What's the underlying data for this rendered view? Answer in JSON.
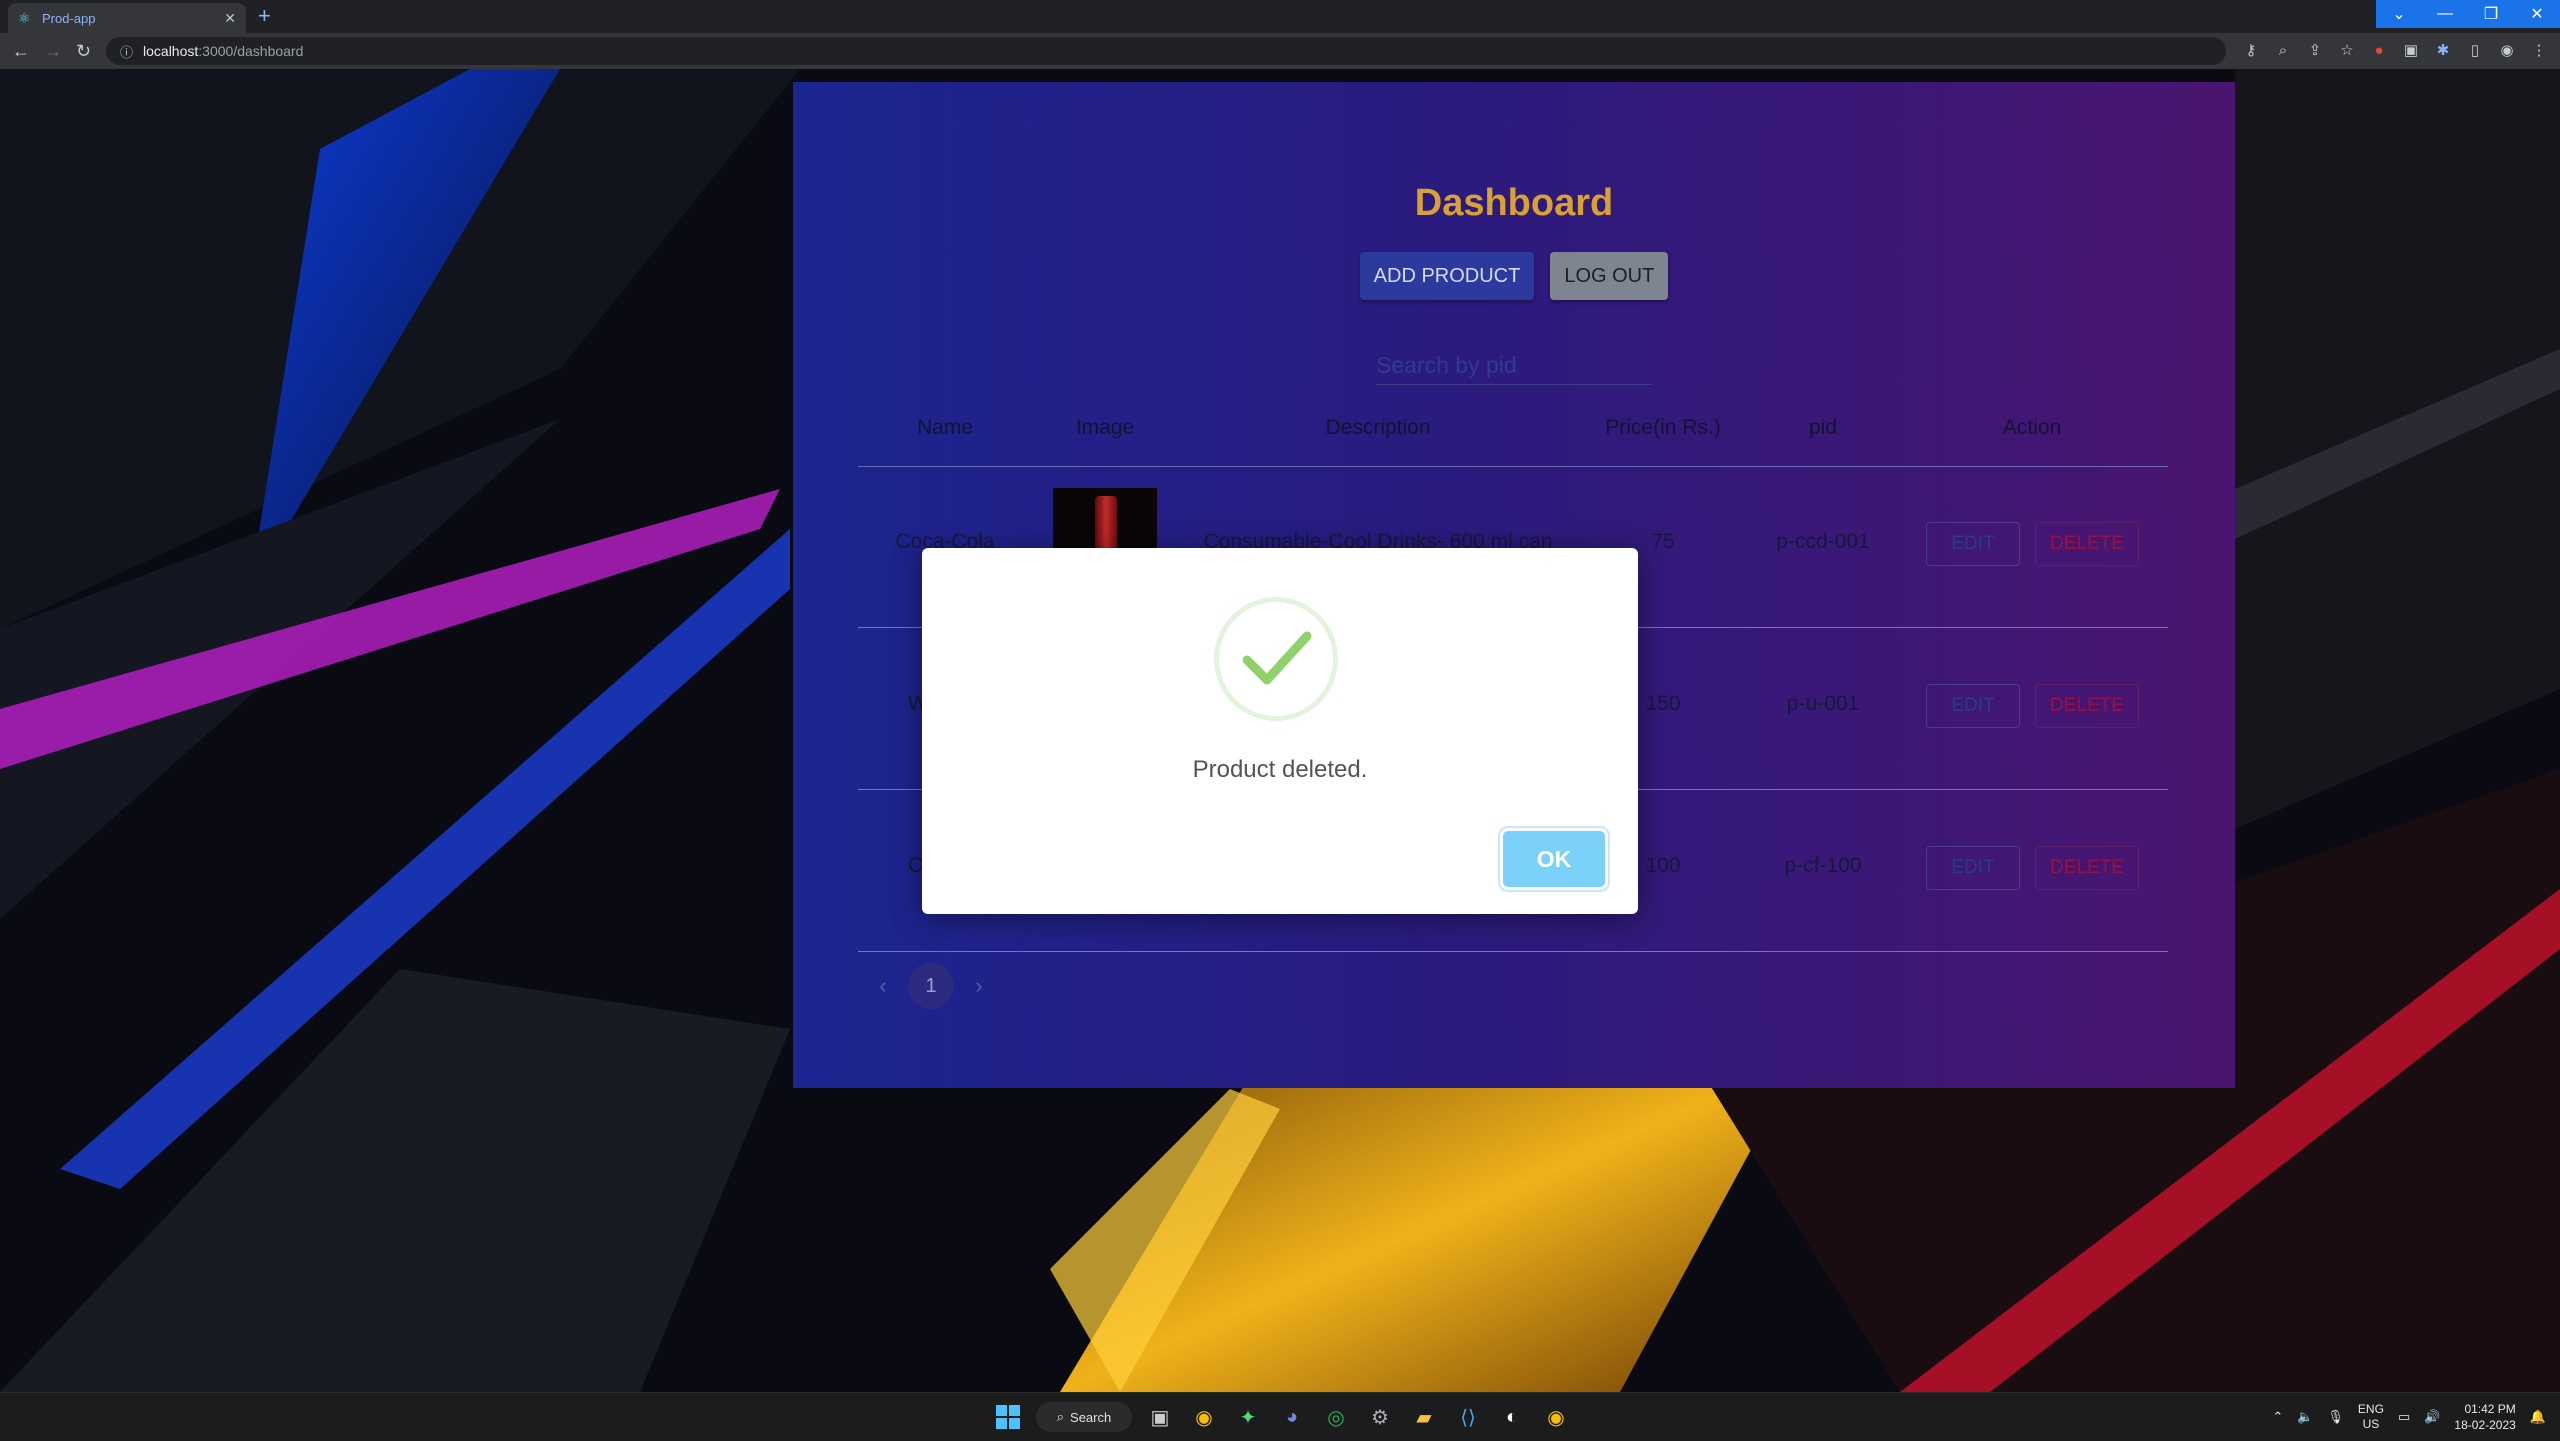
{
  "browser": {
    "tab_title": "Prod-app",
    "tab_close": "✕",
    "new_tab": "+",
    "url_host": "localhost",
    "url_path": ":3000/dashboard",
    "window_controls": {
      "chevron": "⌄",
      "minimize": "—",
      "maximize": "❐",
      "close": "✕"
    },
    "accent_color": "#1a73e8"
  },
  "dashboard": {
    "title": "Dashboard",
    "add_product_label": "ADD PRODUCT",
    "logout_label": "LOG OUT",
    "search_placeholder": "Search by pid",
    "columns": [
      "Name",
      "Image",
      "Description",
      "Price(in Rs.)",
      "pid",
      "Action"
    ],
    "rows": [
      {
        "name": "Coca-Cola",
        "description": "Consumable-Cool Drinks- 600 ml can",
        "price": "75",
        "pid": "p-ccd-001",
        "edit": "EDIT",
        "delete": "DELETE"
      },
      {
        "name": "Wat",
        "description": "",
        "price": "150",
        "pid": "p-u-001",
        "edit": "EDIT",
        "delete": "DELETE"
      },
      {
        "name": "Cup",
        "description": "",
        "price": "100",
        "pid": "p-cf-100",
        "edit": "EDIT",
        "delete": "DELETE"
      }
    ],
    "pagination": {
      "prev": "‹",
      "page": "1",
      "next": "›"
    },
    "title_color": "#d9a033"
  },
  "modal": {
    "message": "Product deleted.",
    "ok_label": "OK",
    "icon": "success-check-icon",
    "ok_color": "#7cd1f9"
  },
  "taskbar": {
    "search_label": "Search",
    "lang_top": "ENG",
    "lang_bottom": "US",
    "time": "01:42 PM",
    "date": "18-02-2023"
  }
}
